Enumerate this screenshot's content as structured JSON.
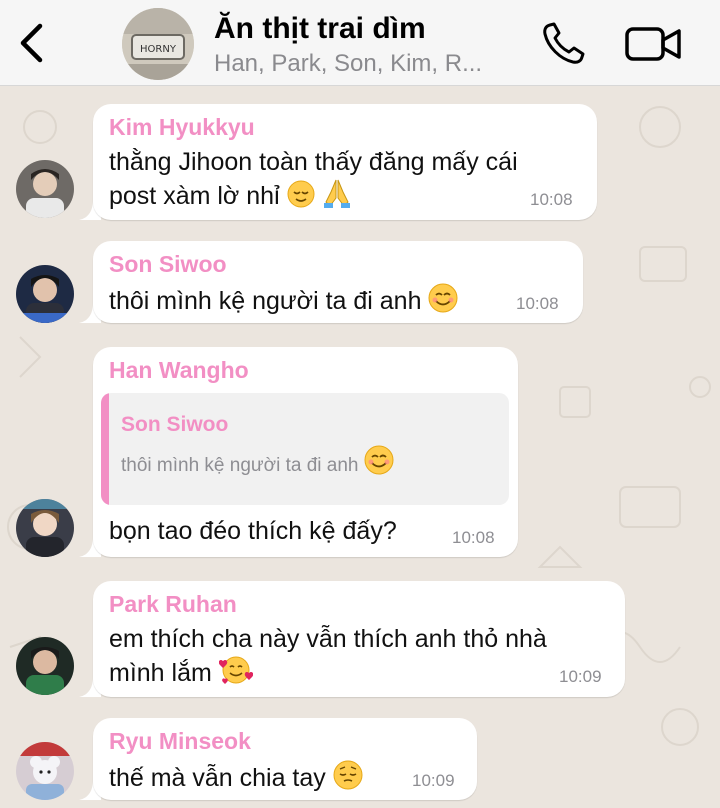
{
  "header": {
    "title": "Ăn thịt trai dìm",
    "subtitle": "Han, Park, Son, Kim, R...",
    "group_avatar_icon": "group-photo-avatar",
    "back_icon": "chevron-left-icon",
    "phone_icon": "phone-icon",
    "video_icon": "video-camera-icon",
    "accent_color": "#f28fc4"
  },
  "messages": [
    {
      "sender": "Kim Hyukkyu",
      "lines": [
        "thằng Jihoon toàn thấy đăng mấy cái",
        "post xàm lờ nhỉ"
      ],
      "emoji": [
        "relieved-face",
        "folded-hands"
      ],
      "time": "10:08"
    },
    {
      "sender": "Son Siwoo",
      "lines": [
        "thôi mình kệ người ta đi anh"
      ],
      "emoji": [
        "smiling-face"
      ],
      "time": "10:08"
    },
    {
      "sender": "Han Wangho",
      "quote": {
        "sender": "Son Siwoo",
        "text": "thôi mình kệ người ta đi anh",
        "emoji": "smiling-face"
      },
      "lines": [
        "bọn tao đéo thích kệ đấy?"
      ],
      "time": "10:08"
    },
    {
      "sender": "Park Ruhan",
      "lines": [
        "em thích cha này vẫn thích anh thỏ nhà",
        "mình lắm"
      ],
      "emoji": [
        "smiling-face-with-hearts"
      ],
      "time": "10:09"
    },
    {
      "sender": "Ryu Minseok",
      "lines": [
        "thế mà vẫn chia tay"
      ],
      "emoji": [
        "pensive-face"
      ],
      "time": "10:09"
    }
  ]
}
